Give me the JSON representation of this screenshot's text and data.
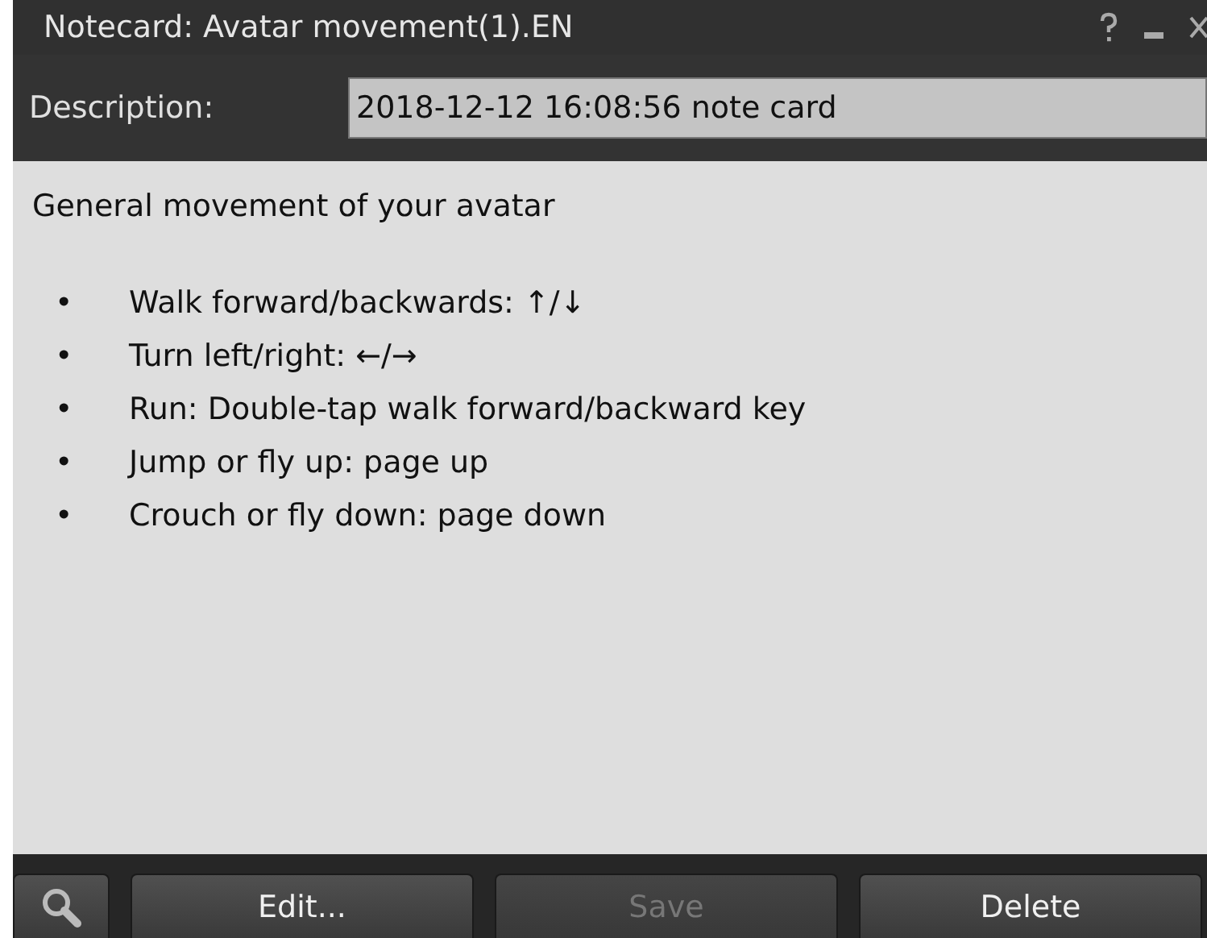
{
  "window": {
    "title": "Notecard: Avatar movement(1).EN"
  },
  "description": {
    "label": "Description:",
    "value": "2018-12-12 16:08:56 note card"
  },
  "body": {
    "heading": "General movement of your avatar",
    "bullets": [
      "Walk forward/backwards: ↑/↓",
      "Turn left/right: ←/→",
      "Run: Double-tap walk forward/backward key",
      "Jump or fly up: page up",
      "Crouch or fly down: page down"
    ],
    "bullet_mark": "•"
  },
  "buttons": [
    {
      "label": "Edit...",
      "disabled": false
    },
    {
      "label": "Save",
      "disabled": true
    },
    {
      "label": "Delete",
      "disabled": false
    }
  ]
}
